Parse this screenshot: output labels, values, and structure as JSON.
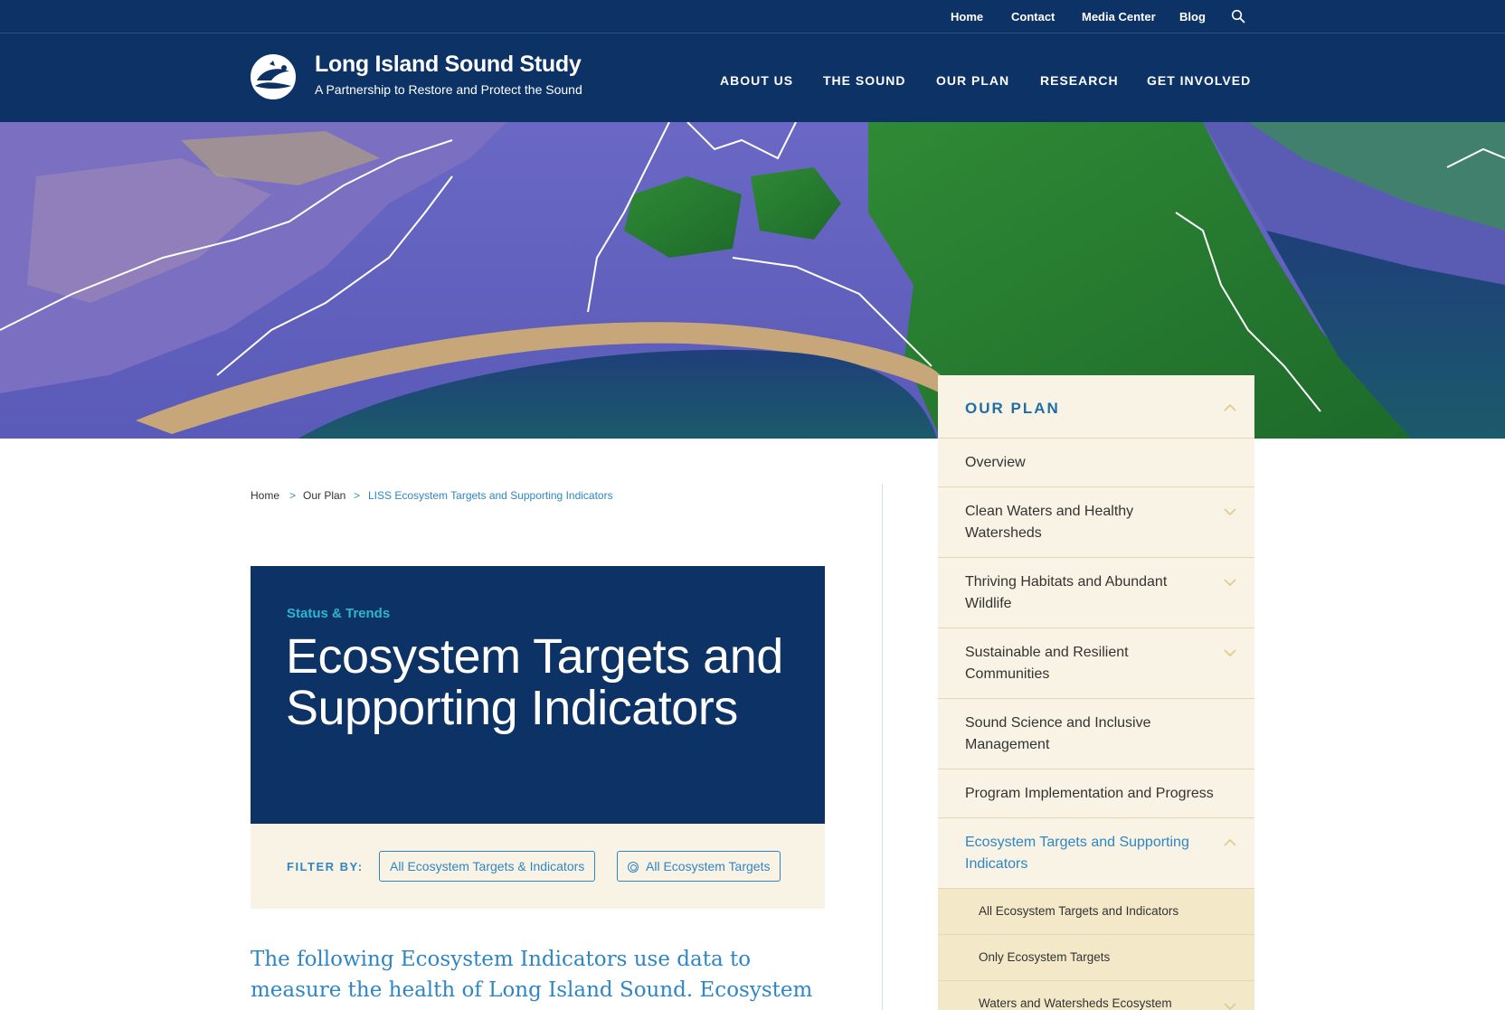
{
  "utility_nav": {
    "home": "Home",
    "contact": "Contact",
    "media_center": "Media Center",
    "blog": "Blog",
    "search_icon": "search-icon"
  },
  "brand": {
    "title": "Long Island Sound Study",
    "subtitle": "A Partnership to Restore and Protect the Sound"
  },
  "main_nav": [
    "ABOUT US",
    "THE SOUND",
    "OUR PLAN",
    "RESEARCH",
    "GET INVOLVED"
  ],
  "breadcrumb": {
    "home": "Home",
    "sep": ">",
    "our_plan": "Our Plan",
    "current": "LISS Ecosystem Targets and Supporting Indicators"
  },
  "card": {
    "eyebrow": "Status & Trends",
    "title": "Ecosystem Targets and Supporting Indicators"
  },
  "filter": {
    "label": "FILTER BY:",
    "btn_all": "All Ecosystem Targets & Indicators",
    "btn_targets": "All Ecosystem Targets"
  },
  "intro": "The following Ecosystem Indicators use data to measure the health of Long Island Sound. Ecosystem Targets are",
  "sidebar": {
    "heading": "OUR PLAN",
    "items": [
      "Overview",
      "Clean Waters and Healthy Watersheds",
      "Thriving Habitats and Abundant Wildlife",
      "Sustainable and Resilient Communities",
      "Sound Science and Inclusive Management",
      "Program Implementation and Progress",
      "Ecosystem Targets and Supporting Indicators"
    ],
    "subitems": [
      "All Ecosystem Targets and Indicators",
      "Only Ecosystem Targets",
      "Waters and Watersheds Ecosystem"
    ]
  },
  "colors": {
    "navy": "#0d3366",
    "accent_blue": "#2f86c4",
    "cream": "#f8f3e4"
  }
}
